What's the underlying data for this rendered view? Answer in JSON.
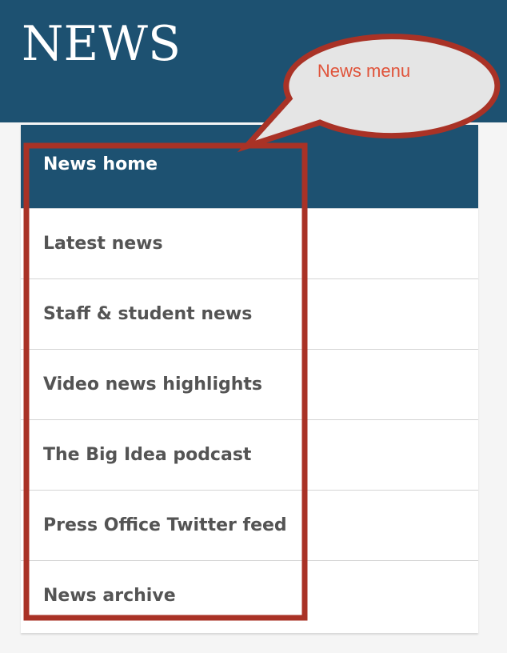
{
  "header": {
    "title": "NEWS"
  },
  "menu": {
    "items": [
      {
        "label": "News home"
      },
      {
        "label": "Latest news"
      },
      {
        "label": "Staff & student news"
      },
      {
        "label": "Video news highlights"
      },
      {
        "label": "The Big Idea podcast"
      },
      {
        "label": "Press Office Twitter feed"
      },
      {
        "label": "News archive"
      }
    ]
  },
  "annotation": {
    "label": "News menu"
  },
  "colors": {
    "brand_blue": "#1d5171",
    "annotation_red": "#a93226",
    "annotation_text": "#e0533a",
    "bubble_fill": "#e5e5e5",
    "menu_text": "#545454"
  }
}
